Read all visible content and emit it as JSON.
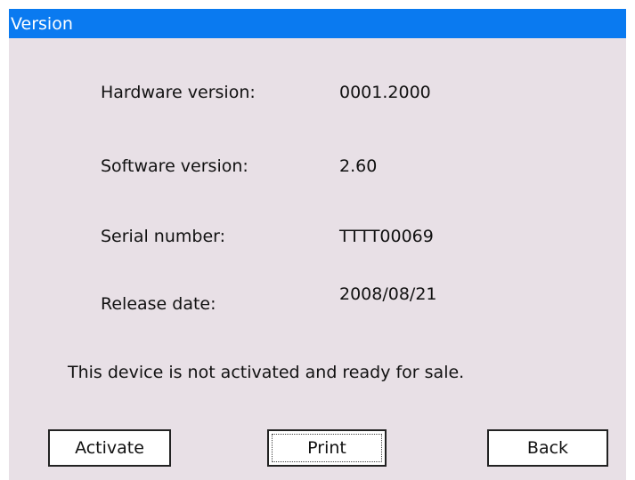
{
  "window": {
    "title": "Version"
  },
  "info": {
    "hardware_label": "Hardware version:",
    "hardware_value": "0001.2000",
    "software_label": "Software version:",
    "software_value": "2.60",
    "serial_label": "Serial number:",
    "serial_value": "TTTT00069",
    "release_label": "Release date:",
    "release_value": "2008/08/21"
  },
  "status": {
    "message": "This device is not activated and ready for sale."
  },
  "buttons": {
    "activate": "Activate",
    "print": "Print",
    "back": "Back"
  },
  "colors": {
    "titlebar": "#0a7af0",
    "background": "#e8e0e6",
    "button_face": "#ffffff"
  }
}
